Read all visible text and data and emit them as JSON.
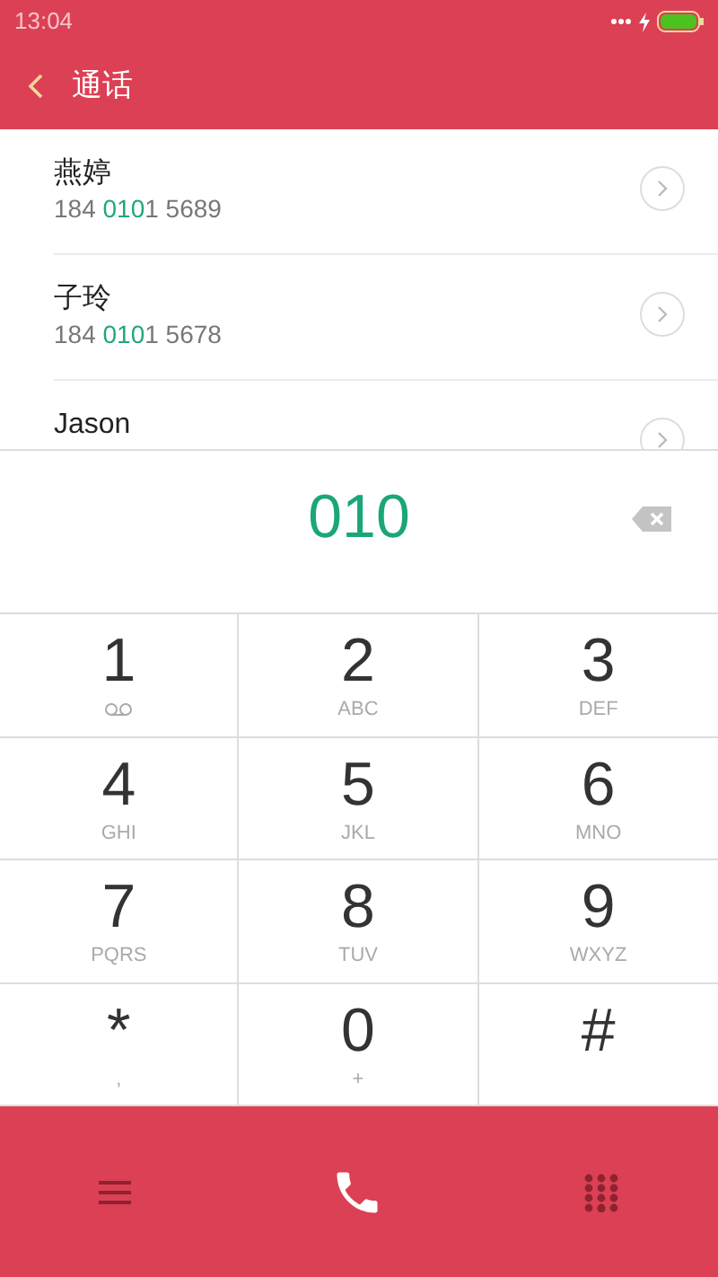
{
  "status_bar": {
    "time": "13:04",
    "charging": true
  },
  "header": {
    "title": "通话"
  },
  "contacts": [
    {
      "name": "燕婷",
      "number": [
        {
          "text": "184 ",
          "match": false
        },
        {
          "text": "010",
          "match": true
        },
        {
          "text": "1 5689",
          "match": false
        }
      ]
    },
    {
      "name": "子玲",
      "number": [
        {
          "text": "184 ",
          "match": false
        },
        {
          "text": "010",
          "match": true
        },
        {
          "text": "1 5678",
          "match": false
        }
      ]
    },
    {
      "name": "Jason"
    }
  ],
  "dialed": "010",
  "keys": [
    {
      "digit": "1",
      "kind": "voicemail"
    },
    {
      "digit": "2",
      "letters": "ABC",
      "kind": "text"
    },
    {
      "digit": "3",
      "letters": "DEF",
      "kind": "text"
    },
    {
      "digit": "4",
      "letters": "GHI",
      "kind": "text"
    },
    {
      "digit": "5",
      "letters": "JKL",
      "kind": "text"
    },
    {
      "digit": "6",
      "letters": "MNO",
      "kind": "text"
    },
    {
      "digit": "7",
      "letters": "PQRS",
      "kind": "text"
    },
    {
      "digit": "8",
      "letters": "TUV",
      "kind": "text"
    },
    {
      "digit": "9",
      "letters": "WXYZ",
      "kind": "text"
    },
    {
      "digit": "*",
      "letters": ",",
      "kind": "text"
    },
    {
      "digit": "0",
      "letters": "+",
      "kind": "text"
    },
    {
      "digit": "#",
      "kind": "none"
    }
  ]
}
